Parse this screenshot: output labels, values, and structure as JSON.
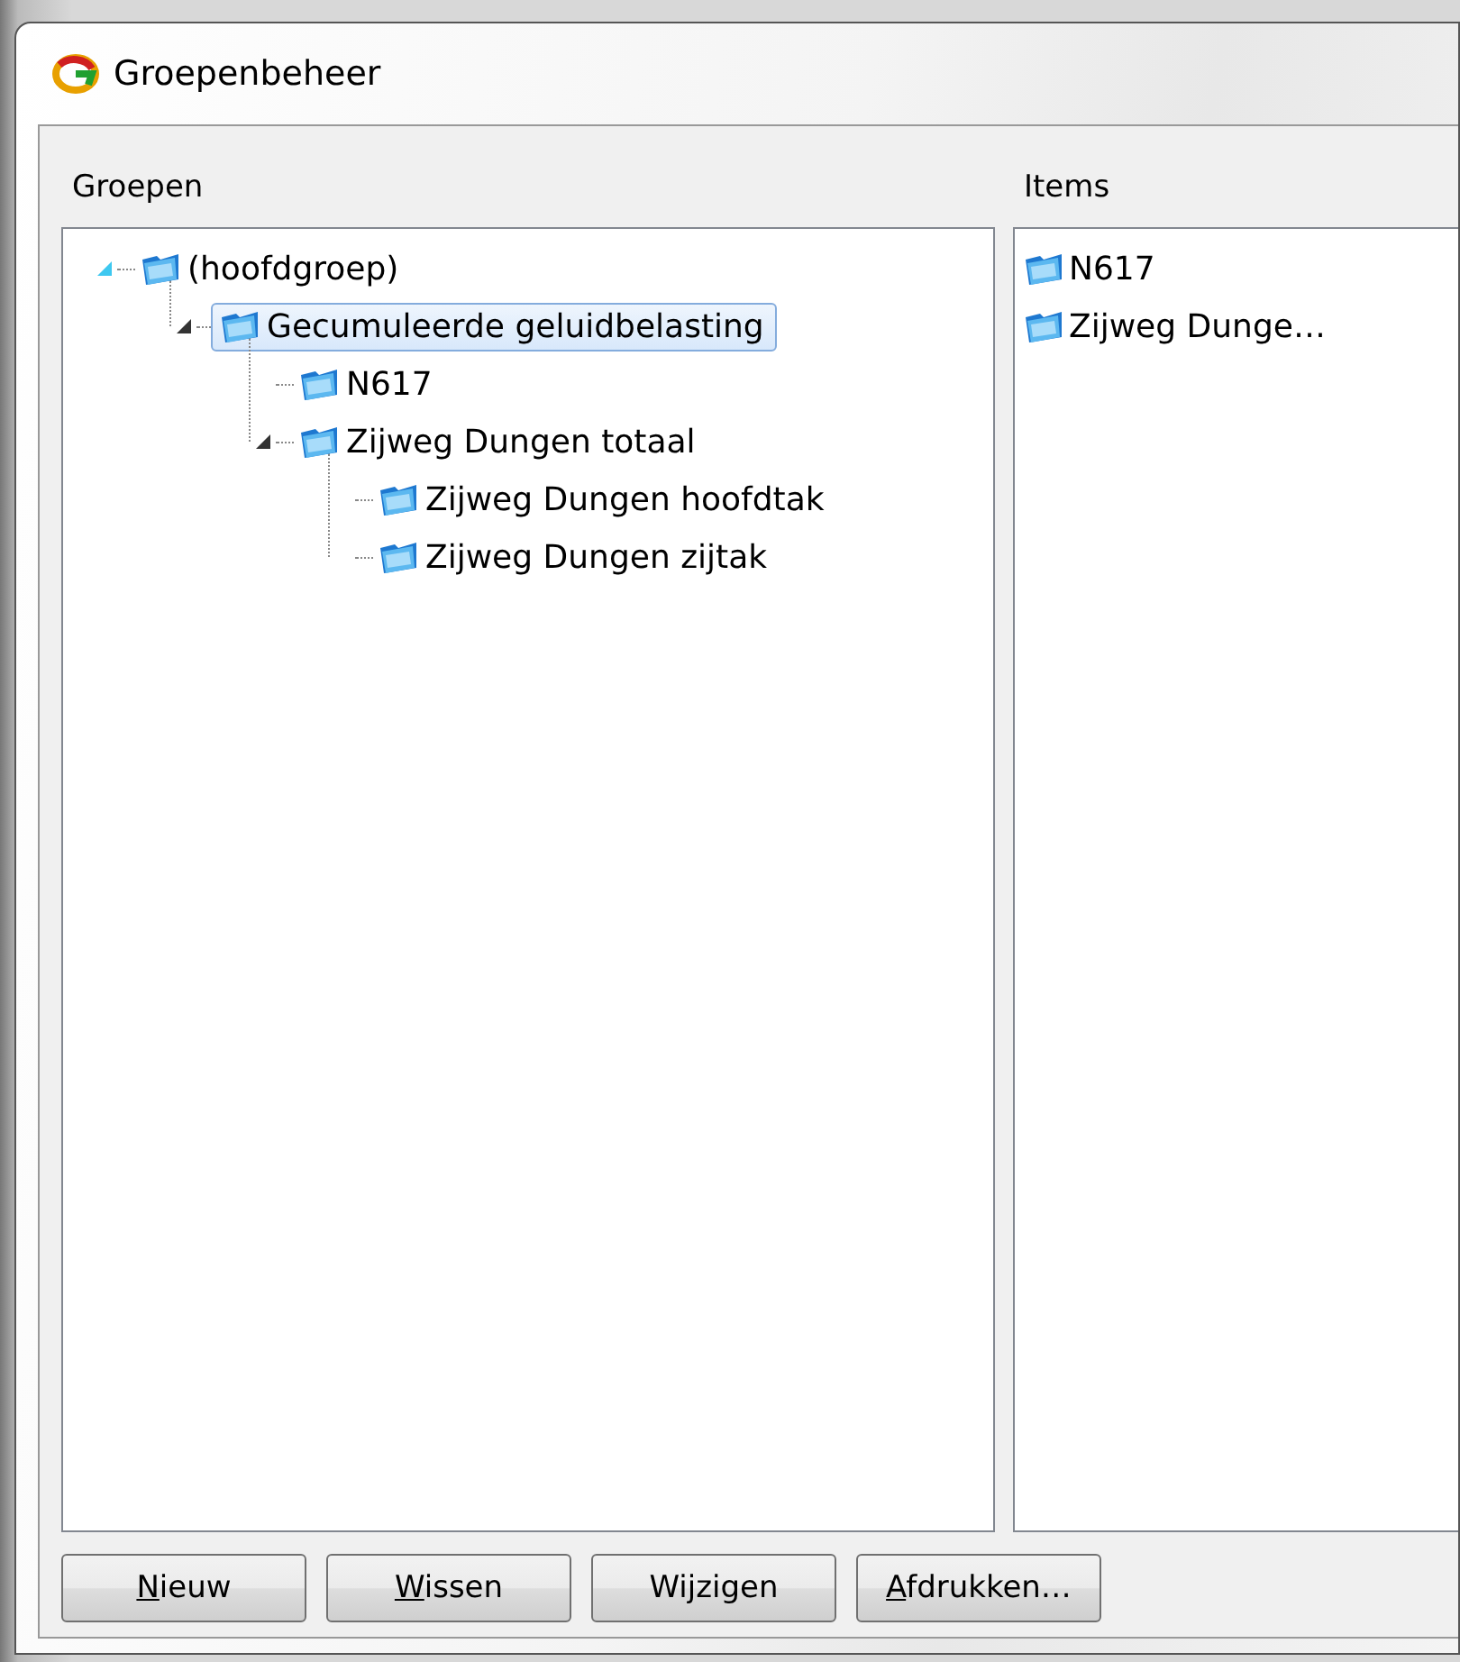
{
  "window": {
    "title": "Groepenbeheer"
  },
  "groups": {
    "label": "Groepen",
    "tree": [
      {
        "label": "(hoofdgroep)",
        "expanded": true,
        "hovered": true,
        "selected": false,
        "children": [
          {
            "label": "Gecumuleerde geluidbelasting",
            "expanded": true,
            "hovered": false,
            "selected": true,
            "children": [
              {
                "label": "N617",
                "selected": false
              },
              {
                "label": "Zijweg Dungen totaal",
                "expanded": true,
                "hovered": false,
                "selected": false,
                "children": [
                  {
                    "label": "Zijweg Dungen hoofdtak",
                    "selected": false
                  },
                  {
                    "label": "Zijweg Dungen zijtak",
                    "selected": false
                  }
                ]
              }
            ]
          }
        ]
      }
    ]
  },
  "items": {
    "label": "Items",
    "list": [
      {
        "label": "N617"
      },
      {
        "label": "Zijweg Dunge…"
      }
    ]
  },
  "buttons": [
    {
      "label": "Nieuw",
      "underline_first": true
    },
    {
      "label": "Wissen",
      "underline_first": true
    },
    {
      "label": "Wijzigen",
      "underline_first": false
    },
    {
      "label": "Afdrukken…",
      "underline_first": true
    }
  ]
}
